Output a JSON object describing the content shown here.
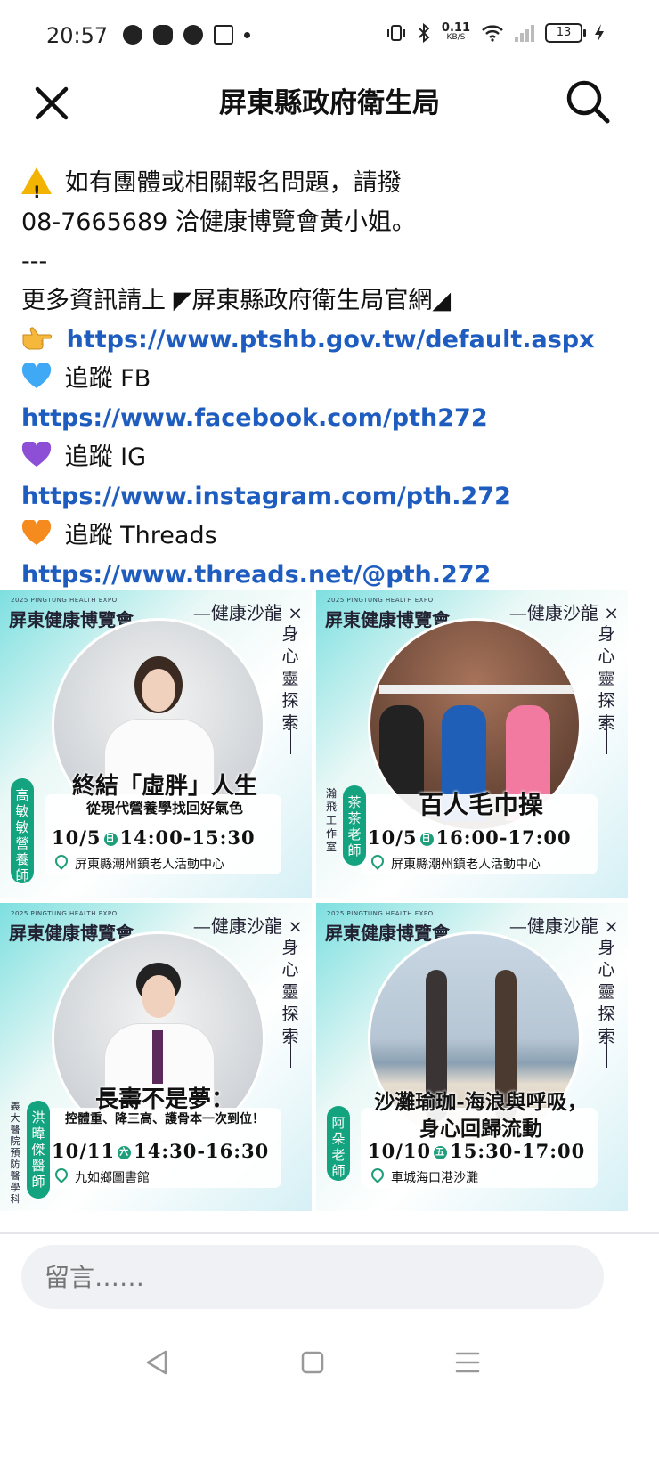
{
  "status_bar": {
    "time": "20:57",
    "left_icons": [
      "messenger-icon",
      "discord-icon",
      "line-icon",
      "notion-icon",
      "dot-icon"
    ],
    "net_speed_value": "0.11",
    "net_speed_unit": "KB/S",
    "battery": "13",
    "right_icons": [
      "vibrate-icon",
      "bluetooth-icon",
      "wifi-icon",
      "signal-icon",
      "battery-icon",
      "charging-icon"
    ]
  },
  "header": {
    "title": "屏東縣政府衛生局"
  },
  "post": {
    "line1": "如有團體或相關報名問題，請撥",
    "line2": "08-7665689 洽健康博覽會黃小姐。",
    "separator": "---",
    "line3": "更多資訊請上 ◤屏東縣政府衛生局官網◢",
    "link_site": "https://www.ptshb.gov.tw/default.aspx",
    "fb_label": "追蹤 FB",
    "link_fb": "https://www.facebook.com/pth272",
    "ig_label": "追蹤 IG",
    "link_ig": "https://www.instagram.com/pth.272",
    "threads_label": "追蹤 Threads",
    "link_threads": "https://www.threads.net/@pth.272",
    "colors": {
      "link": "#1e5dbf",
      "fb_heart": "#3fa9f5",
      "ig_heart": "#8c4fd6",
      "threads_heart": "#f58a1f"
    }
  },
  "cards": [
    {
      "brand_en": "2025 PINGTUNG HEALTH EXPO",
      "brand": "屏東健康博覽會",
      "salon": "—健康沙龍 ×",
      "vertical": "身心靈探索",
      "title": "終結「虛胖」人生",
      "subtitle": "從現代營養學找回好氣色",
      "date": "10/5",
      "day": "日",
      "time": "14:00-15:30",
      "place": "屏東縣潮州鎮老人活動中心",
      "speaker": "高敏敏營養師",
      "org": ""
    },
    {
      "brand_en": "2025 PINGTUNG HEALTH EXPO",
      "brand": "屏東健康博覽會",
      "salon": "—健康沙龍 ×",
      "vertical": "身心靈探索",
      "title": "百人毛巾操",
      "subtitle": "",
      "date": "10/5",
      "day": "日",
      "time": "16:00-17:00",
      "place": "屏東縣潮州鎮老人活動中心",
      "speaker": "茶茶老師",
      "org": "瀚飛工作室"
    },
    {
      "brand_en": "2025 PINGTUNG HEALTH EXPO",
      "brand": "屏東健康博覽會",
      "salon": "—健康沙龍 ×",
      "vertical": "身心靈探索",
      "title": "長壽不是夢：",
      "subtitle": "控體重、降三高、護骨本一次到位！",
      "date": "10/11",
      "day": "六",
      "time": "14:30-16:30",
      "place": "九如鄉圖書館",
      "speaker": "洪暐傑醫師",
      "org": "義大醫院 預防醫學科"
    },
    {
      "brand_en": "2025 PINGTUNG HEALTH EXPO",
      "brand": "屏東健康博覽會",
      "salon": "—健康沙龍 ×",
      "vertical": "身心靈探索",
      "title": "沙灘瑜珈-海浪與呼吸，",
      "subtitle": "身心回歸流動",
      "date": "10/10",
      "day": "五",
      "time": "15:30-17:00",
      "place": "車城海口港沙灘",
      "speaker": "阿朵老師",
      "org": ""
    }
  ],
  "comment": {
    "placeholder": "留言……"
  },
  "nav": {
    "buttons": [
      "back-icon",
      "home-icon",
      "menu-icon"
    ]
  }
}
